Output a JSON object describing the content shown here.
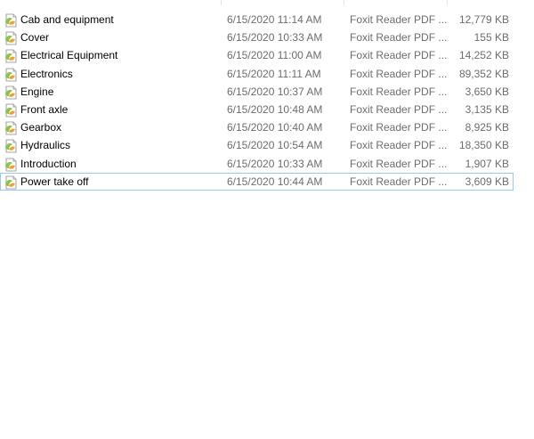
{
  "files": [
    {
      "name": "Cab and equipment",
      "date": "6/15/2020 11:14 AM",
      "type": "Foxit Reader PDF ...",
      "size": "12,779 KB",
      "icon": "pdf-file-icon"
    },
    {
      "name": "Cover",
      "date": "6/15/2020 10:33 AM",
      "type": "Foxit Reader PDF ...",
      "size": "155 KB",
      "icon": "pdf-file-icon"
    },
    {
      "name": "Electrical Equipment",
      "date": "6/15/2020 11:00 AM",
      "type": "Foxit Reader PDF ...",
      "size": "14,252 KB",
      "icon": "pdf-file-icon"
    },
    {
      "name": "Electronics",
      "date": "6/15/2020 11:11 AM",
      "type": "Foxit Reader PDF ...",
      "size": "89,352 KB",
      "icon": "pdf-file-icon"
    },
    {
      "name": "Engine",
      "date": "6/15/2020 10:37 AM",
      "type": "Foxit Reader PDF ...",
      "size": "3,650 KB",
      "icon": "pdf-file-icon"
    },
    {
      "name": "Front axle",
      "date": "6/15/2020 10:48 AM",
      "type": "Foxit Reader PDF ...",
      "size": "3,135 KB",
      "icon": "pdf-file-icon"
    },
    {
      "name": "Gearbox",
      "date": "6/15/2020 10:40 AM",
      "type": "Foxit Reader PDF ...",
      "size": "8,925 KB",
      "icon": "pdf-file-icon"
    },
    {
      "name": "Hydraulics",
      "date": "6/15/2020 10:54 AM",
      "type": "Foxit Reader PDF ...",
      "size": "18,350 KB",
      "icon": "pdf-file-icon"
    },
    {
      "name": "Introduction",
      "date": "6/15/2020 10:33 AM",
      "type": "Foxit Reader PDF ...",
      "size": "1,907 KB",
      "icon": "pdf-file-icon"
    },
    {
      "name": "Power take off",
      "date": "6/15/2020 10:44 AM",
      "type": "Foxit Reader PDF ...",
      "size": "3,609 KB",
      "icon": "pdf-file-icon",
      "selected": true
    }
  ],
  "colors": {
    "selection_border": "#99c9ef",
    "secondary_text": "#6d6d6d",
    "icon_green": "#8cc34a",
    "icon_orange": "#f0a030"
  }
}
